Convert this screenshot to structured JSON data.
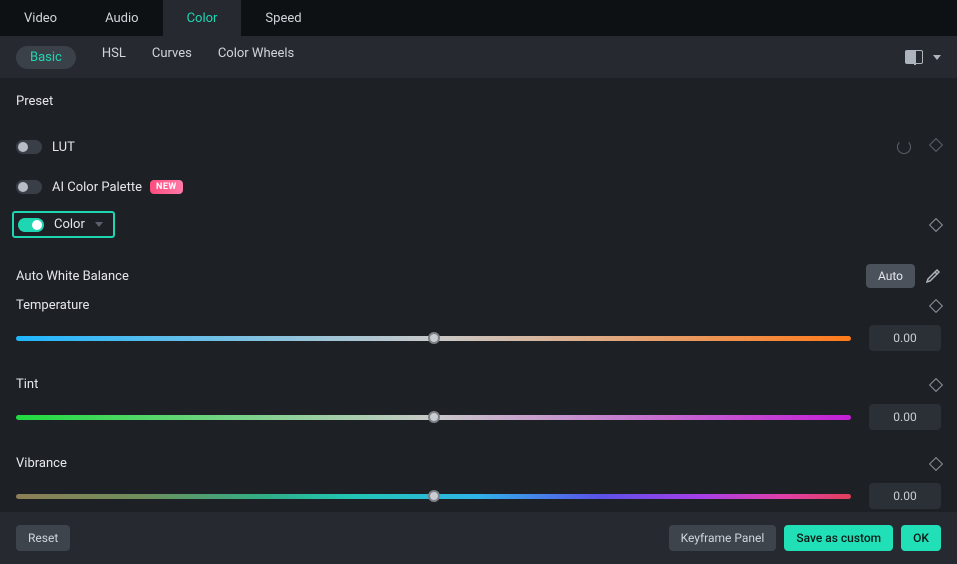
{
  "top_tabs": {
    "video": "Video",
    "audio": "Audio",
    "color": "Color",
    "speed": "Speed"
  },
  "sub_tabs": {
    "basic": "Basic",
    "hsl": "HSL",
    "curves": "Curves",
    "wheels": "Color Wheels"
  },
  "preset_label": "Preset",
  "lut_label": "LUT",
  "ai_palette_label": "AI Color Palette",
  "new_badge": "NEW",
  "color_label": "Color",
  "awb_label": "Auto White Balance",
  "auto_btn": "Auto",
  "sliders": {
    "temperature": {
      "label": "Temperature",
      "value": "0.00"
    },
    "tint": {
      "label": "Tint",
      "value": "0.00"
    },
    "vibrance": {
      "label": "Vibrance",
      "value": "0.00"
    }
  },
  "bottom": {
    "reset": "Reset",
    "keyframe": "Keyframe Panel",
    "save_custom": "Save as custom",
    "ok": "OK"
  }
}
